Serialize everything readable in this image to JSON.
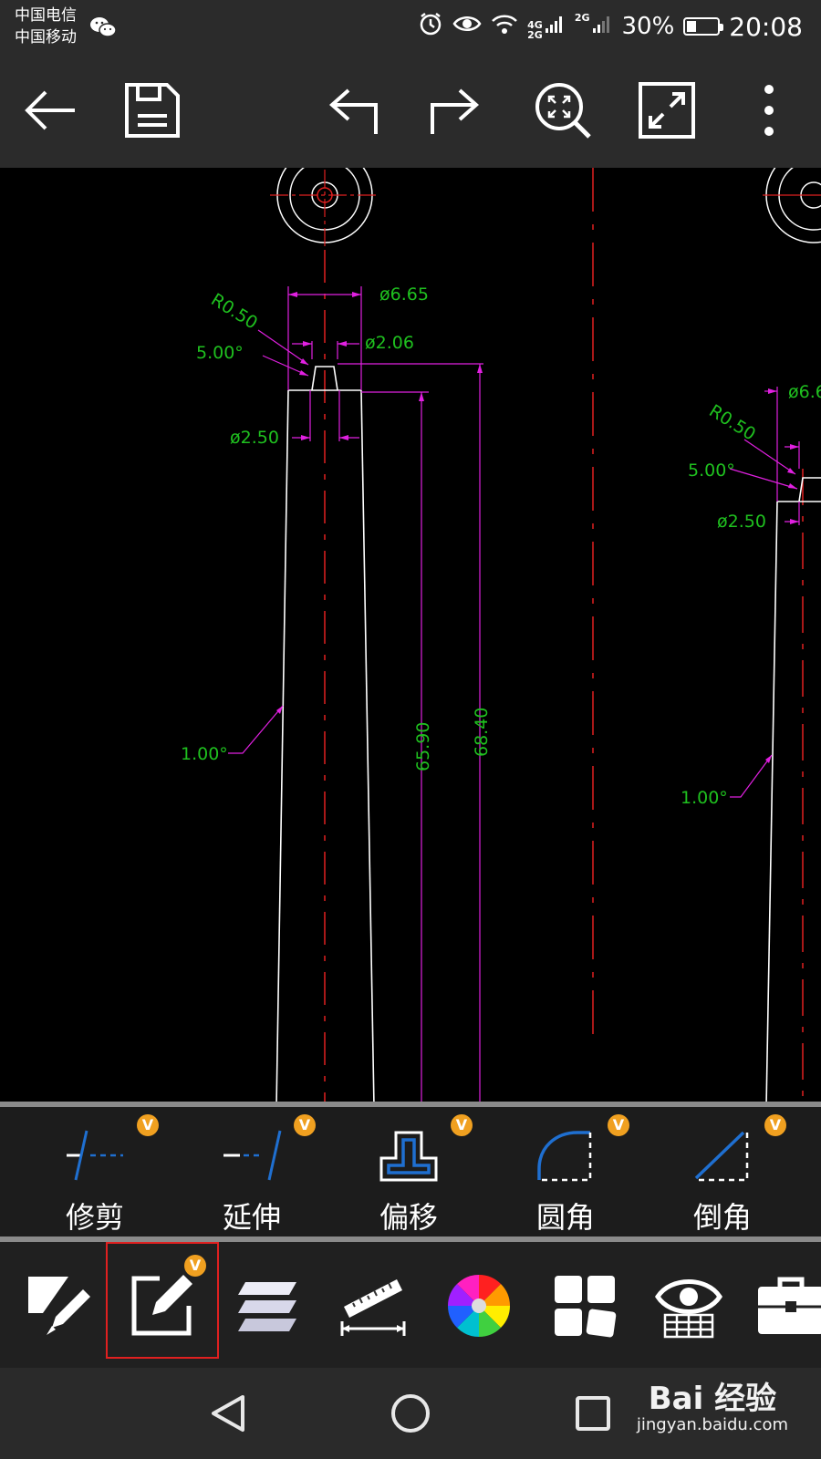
{
  "status_bar": {
    "carrier_1": "中国电信",
    "carrier_2": "中国移动",
    "network_1": "4G",
    "network_2": "2G",
    "network_3": "2G",
    "battery": "30%",
    "battery_level": 0.3,
    "time": "20:08"
  },
  "toolbar": {
    "icons": [
      "back-arrow-icon",
      "save-icon",
      "undo-icon",
      "redo-icon",
      "zoom-extents-icon",
      "fullscreen-icon",
      "more-vertical-icon"
    ]
  },
  "drawing": {
    "dims_left": {
      "d_top": "ø6.65",
      "d_tip": "ø2.06",
      "d_mid": "ø2.50",
      "radius": "R0.50",
      "angle_top": "5.00°",
      "angle_taper": "1.00°",
      "height_1": "65.90",
      "height_2": "68.40"
    },
    "dims_right": {
      "d_top": "ø6.6",
      "d_mid": "ø2.50",
      "radius": "R0.50",
      "angle_top": "5.00°",
      "angle_taper": "1.00°"
    },
    "colors": {
      "outline": "#ffffff",
      "dimension": "#e020e0",
      "text": "#1fc01f",
      "centerline": "#e02020"
    }
  },
  "edit_tools": [
    {
      "label": "修剪",
      "icon": "trim-icon",
      "badge": "V"
    },
    {
      "label": "延伸",
      "icon": "extend-icon",
      "badge": "V"
    },
    {
      "label": "偏移",
      "icon": "offset-icon",
      "badge": "V"
    },
    {
      "label": "圆角",
      "icon": "fillet-icon",
      "badge": "V"
    },
    {
      "label": "倒角",
      "icon": "chamfer-icon",
      "badge": "V"
    }
  ],
  "bottom_bar": {
    "items": [
      "draw-icon",
      "edit-icon",
      "layers-icon",
      "measure-icon",
      "color-wheel-icon",
      "blocks-icon",
      "view-icon",
      "toolbox-icon"
    ],
    "edit_badge": "V"
  },
  "watermark": {
    "main": "Bai 经验",
    "sub": "jingyan.baidu.com"
  }
}
